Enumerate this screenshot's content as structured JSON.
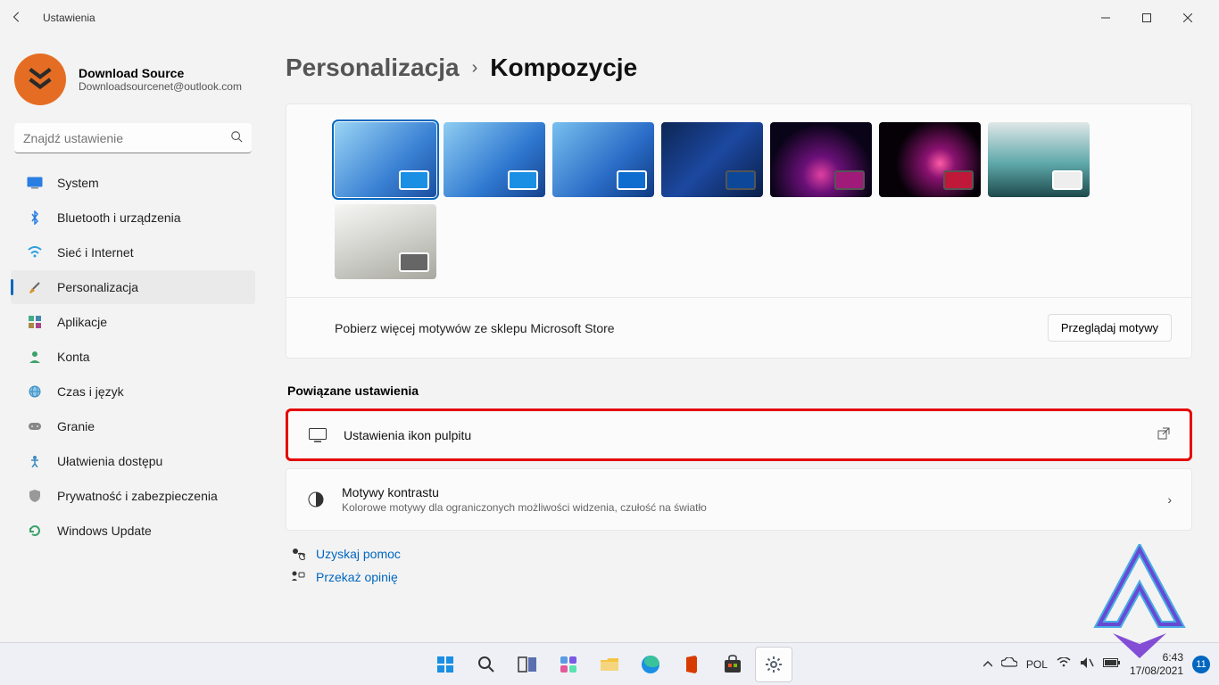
{
  "window": {
    "title": "Ustawienia"
  },
  "account": {
    "name": "Download Source",
    "email": "Downloadsourcenet@outlook.com"
  },
  "search": {
    "placeholder": "Znajdź ustawienie"
  },
  "nav": {
    "items": [
      {
        "label": "System"
      },
      {
        "label": "Bluetooth i urządzenia"
      },
      {
        "label": "Sieć i Internet"
      },
      {
        "label": "Personalizacja"
      },
      {
        "label": "Aplikacje"
      },
      {
        "label": "Konta"
      },
      {
        "label": "Czas i język"
      },
      {
        "label": "Granie"
      },
      {
        "label": "Ułatwienia dostępu"
      },
      {
        "label": "Prywatność i zabezpieczenia"
      },
      {
        "label": "Windows Update"
      }
    ]
  },
  "breadcrumb": {
    "parent": "Personalizacja",
    "current": "Kompozycje"
  },
  "store": {
    "label": "Pobierz więcej motywów ze sklepu Microsoft Store",
    "button": "Przeglądaj motywy"
  },
  "section": {
    "related": "Powiązane ustawienia"
  },
  "rows": {
    "desktop_icons": {
      "title": "Ustawienia ikon pulpitu"
    },
    "contrast": {
      "title": "Motywy kontrastu",
      "desc": "Kolorowe motywy dla ograniczonych możliwości widzenia, czułość na światło"
    }
  },
  "links": {
    "help": "Uzyskaj pomoc",
    "feedback": "Przekaż opinię"
  },
  "themes": [
    {
      "accent": "#1a8fe3",
      "accent_border": "light",
      "selected": true
    },
    {
      "accent": "#1a8fe3",
      "accent_border": "light",
      "selected": false
    },
    {
      "accent": "#0f6dd0",
      "accent_border": "light",
      "selected": false
    },
    {
      "accent": "#0d479a",
      "accent_border": "dark",
      "selected": false
    },
    {
      "accent": "#a01a7a",
      "accent_border": "dark",
      "selected": false
    },
    {
      "accent": "#c01838",
      "accent_border": "dark",
      "selected": false
    },
    {
      "accent": "#eeeeee",
      "accent_border": "light",
      "selected": false
    },
    {
      "accent": "#666666",
      "accent_border": "light",
      "selected": false
    }
  ],
  "taskbar": {
    "lang": "POL",
    "time": "6:43",
    "date": "17/08/2021",
    "badge": "11"
  }
}
